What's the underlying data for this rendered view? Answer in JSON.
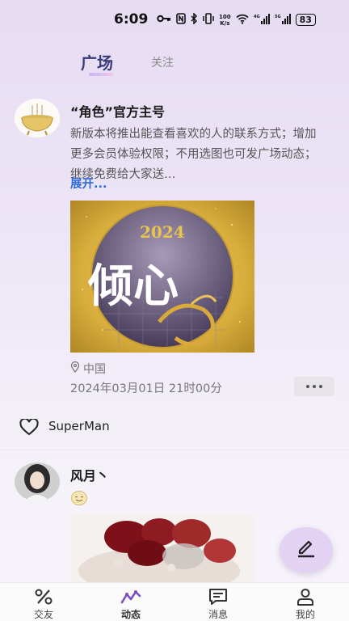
{
  "status_bar": {
    "time": "6:09",
    "speed": "100\nK/s",
    "battery": "83"
  },
  "tabs": {
    "active": "广场",
    "inactive": "关注"
  },
  "posts": [
    {
      "author": "“角色”官方主号",
      "text": "新版本将推出能查看喜欢的人的联系方式；增加更多会员体验权限；不用选图也可发广场动态；继续免费给大家送…",
      "expand_label": "展开...",
      "image_text": "倾心",
      "image_year": "2024",
      "location": "中国",
      "date": "2024年03月01日 21时00分",
      "liked_by": "SuperMan"
    },
    {
      "author": "风月丶"
    }
  ],
  "bottom_nav": [
    {
      "label": "交友"
    },
    {
      "label": "动态"
    },
    {
      "label": "消息"
    },
    {
      "label": "我的"
    }
  ],
  "colors": {
    "accent": "#3a3a7a",
    "link": "#2e6bd8",
    "fab": "#e3d2f4"
  }
}
